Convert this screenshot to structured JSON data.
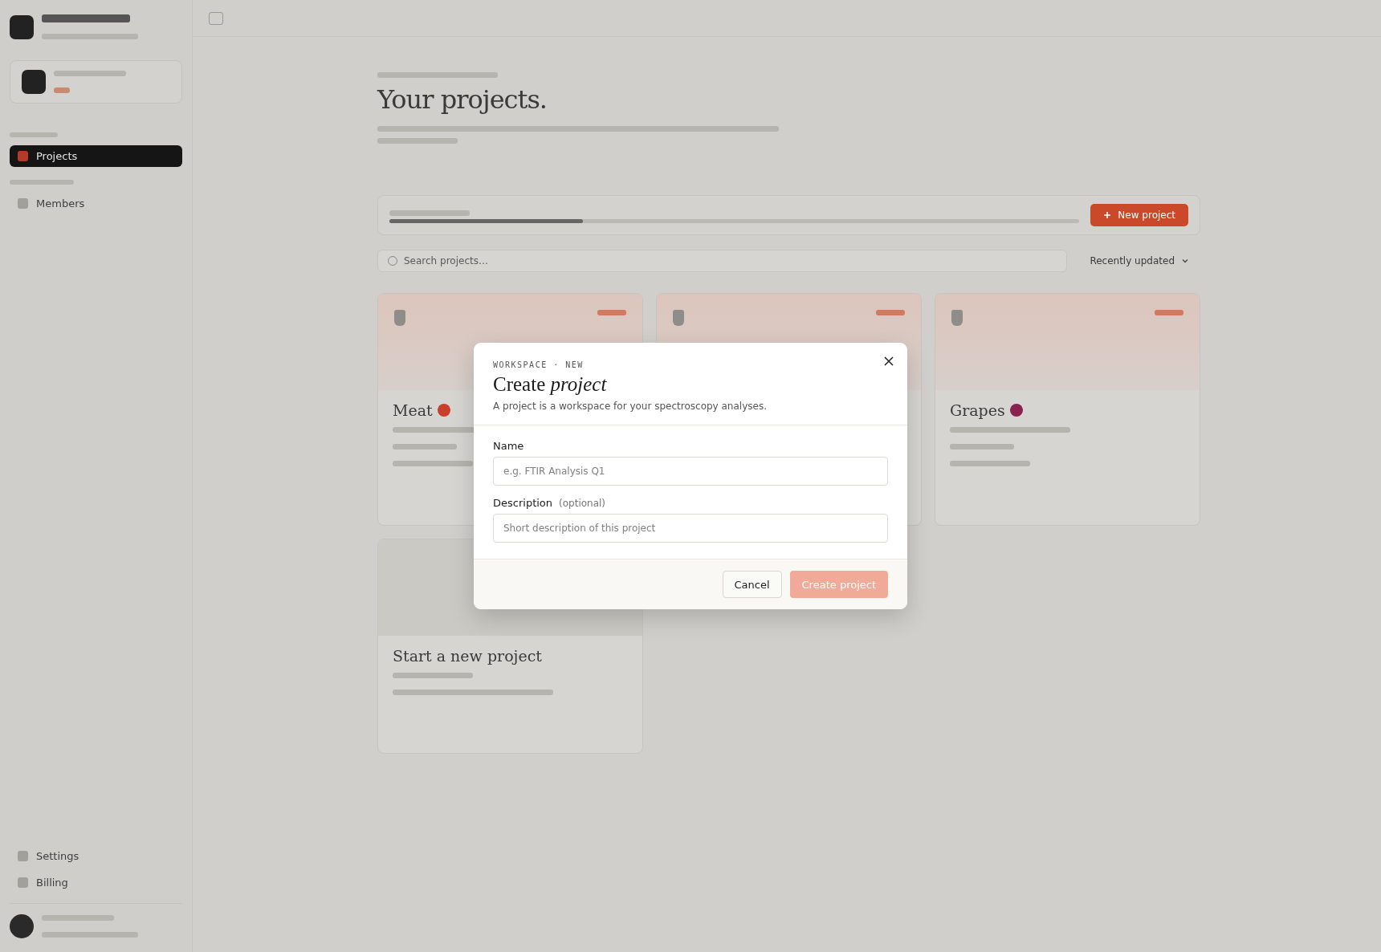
{
  "background": {
    "sidebar": {
      "items": [
        {
          "label": "Projects",
          "selected": true
        },
        {
          "label": "Members",
          "selected": false
        }
      ],
      "footer_items": [
        "Settings",
        "Billing"
      ]
    },
    "title": "Your projects.",
    "new_button": "New project",
    "search": {
      "placeholder": "Search projects…"
    },
    "sort": "Recently updated",
    "projects": [
      {
        "name": "Meat",
        "kind": "project",
        "color": "#c8402c"
      },
      {
        "kind": "hidden"
      },
      {
        "name": "Grapes",
        "kind": "project",
        "color": "#8a2250"
      },
      {
        "name": "Start a new project",
        "kind": "new"
      }
    ]
  },
  "dialog": {
    "eyebrow": "WORKSPACE · NEW",
    "title": "Create *project*",
    "subtitle": "A project is a workspace for your spectroscopy analyses.",
    "fields": [
      {
        "label": "Name",
        "placeholder": "e.g. FTIR Analysis Q1"
      },
      {
        "label": "Description",
        "hint": "(optional)",
        "placeholder": "Short description of this project"
      }
    ],
    "cancel": "Cancel",
    "submit": {
      "label": "Create project",
      "disabled": true
    }
  }
}
